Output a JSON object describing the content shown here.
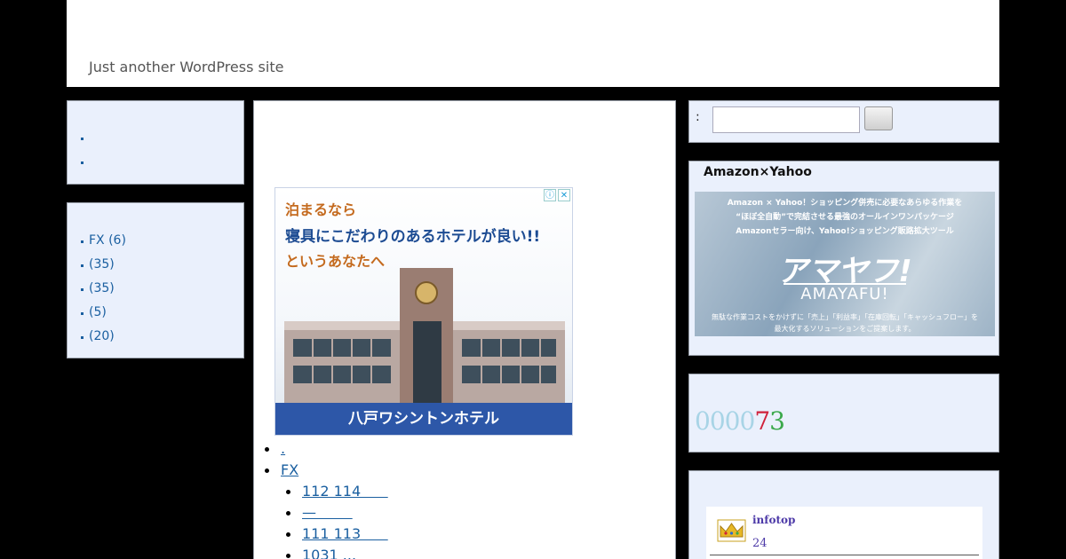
{
  "header": {
    "tagline": "Just another WordPress site"
  },
  "left_nav": {
    "items": [
      "",
      ""
    ]
  },
  "categories": {
    "items": [
      {
        "label": "FX (6)"
      },
      {
        "label": " (35)"
      },
      {
        "label": " (35)"
      },
      {
        "label": " (5)"
      },
      {
        "label": " (20)"
      }
    ]
  },
  "ad": {
    "line1": "泊まるなら",
    "line2": "寝具にこだわりのあるホテルが良い!!",
    "line3": "というあなたへ",
    "hotel_name": "八戸ワシントンホテル",
    "info_icon": "ⓘ",
    "close_icon": "✕"
  },
  "posts": {
    "items": [
      {
        "level": 1,
        "text": "."
      },
      {
        "level": 1,
        "text": "FX"
      },
      {
        "level": 2,
        "text": "112 114      "
      },
      {
        "level": 2,
        "text": "—        "
      },
      {
        "level": 2,
        "text": "111 113      "
      },
      {
        "level": 2,
        "text": "1031 ...      "
      }
    ]
  },
  "search": {
    "label": ":",
    "placeholder": "",
    "value": ""
  },
  "amazon_widget": {
    "title": "Amazon×Yahoo",
    "banner": {
      "line1": "Amazon × Yahoo！ショッピング併売に必要なあらゆる作業を",
      "line2": "“ほぼ全自動”で完結させる最強のオールインワンパッケージ",
      "line3": "Amazonセラー向け、Yahoo!ショッピング販路拡大ツール",
      "logo": "アマヤフ!",
      "sub": "AMAYAFU!",
      "foot1": "無駄な作業コストをかけずに「売上」「利益率」「在庫回転」「キャッシュフロー」を",
      "foot2": "最大化するソリューションをご提案します。"
    }
  },
  "counter": {
    "digits": [
      "0",
      "0",
      "0",
      "0",
      "7",
      "3"
    ],
    "colors": [
      "#a8d4e6",
      "#a8d4e6",
      "#a8d4e6",
      "#a8d4e6",
      "#d0213a",
      "#3aa84a"
    ]
  },
  "infotop": {
    "name": "infotop",
    "number": "24"
  }
}
